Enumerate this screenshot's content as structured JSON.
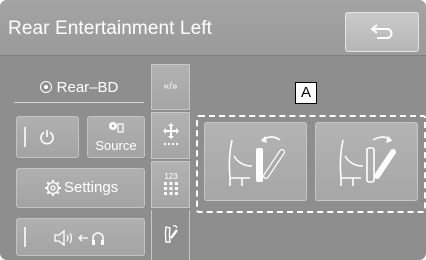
{
  "header": {
    "title": "Rear Entertainment Left",
    "back_icon": "return-arrow-icon"
  },
  "left_panel": {
    "source_indicator": "Rear–BD",
    "power_icon": "power-icon",
    "source_label": "Source",
    "settings_label": "Settings",
    "audio_output_icon": "speaker-to-headphones-icon"
  },
  "side_tabs": {
    "skip_label": "«/»",
    "items": [
      "skip-tab",
      "move-cursor-tab",
      "number-pad-tab",
      "seat-recline-tab"
    ]
  },
  "callout": {
    "label": "A"
  },
  "seat_buttons": [
    {
      "name": "seat-recline-forward-button",
      "icon": "seat-forward-icon"
    },
    {
      "name": "seat-recline-backward-button",
      "icon": "seat-backward-icon"
    }
  ],
  "colors": {
    "panel": "#8e8e8e",
    "button": "#aaaaaa",
    "text": "#ffffff"
  }
}
